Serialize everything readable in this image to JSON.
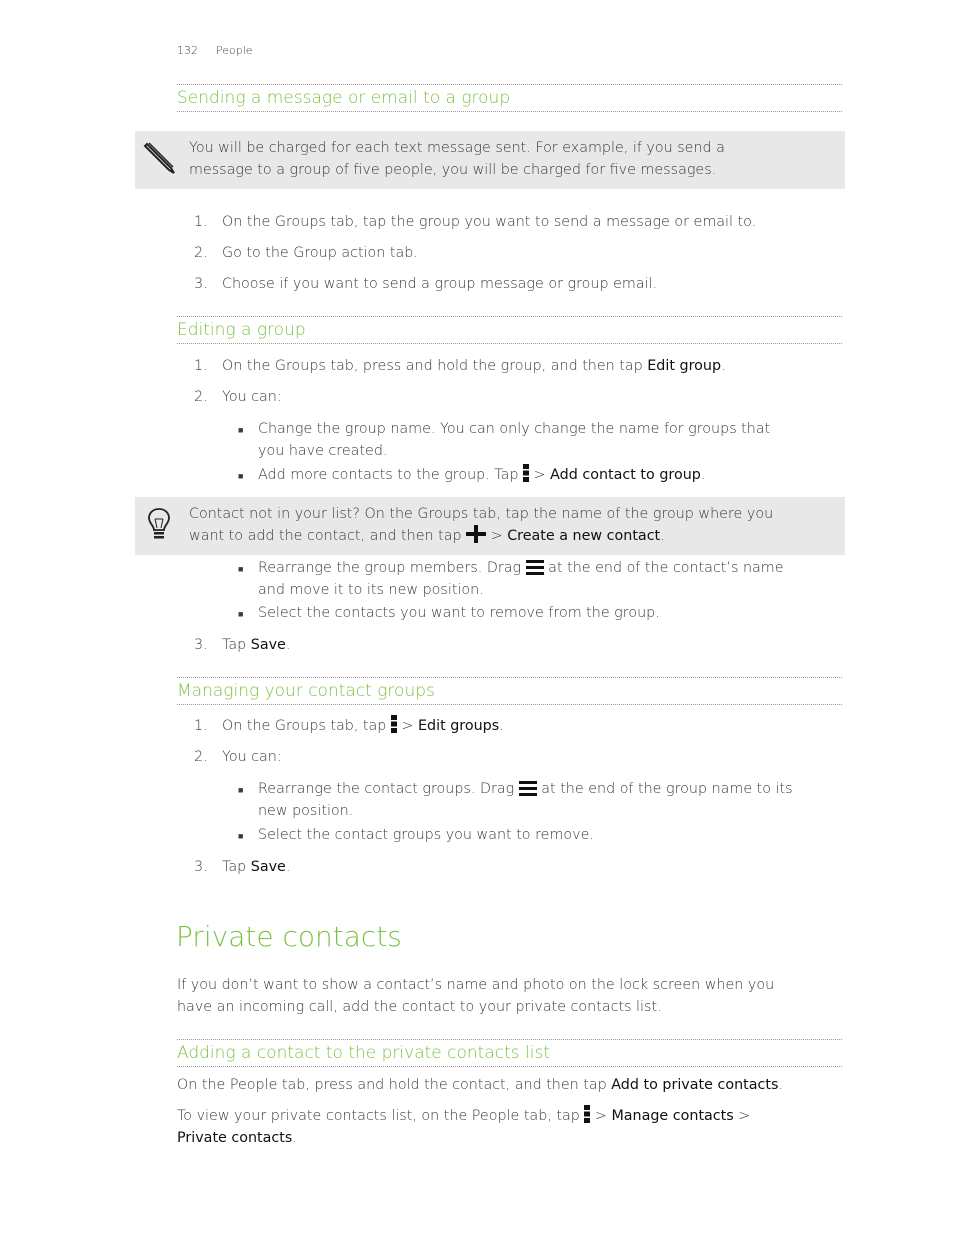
{
  "header": {
    "page_number": "132",
    "chapter": "People"
  },
  "section1": {
    "title": "Sending a message or email to a group",
    "note": {
      "icon": "pencil-icon",
      "lines": [
        "You will be charged for each text message sent. For example, if you send a",
        "message to a group of five people, you will be charged for five messages."
      ]
    },
    "steps": [
      {
        "n": "1.",
        "text": "On the Groups tab, tap the group you want to send a message or email to."
      },
      {
        "n": "2.",
        "text": "Go to the Group action tab."
      },
      {
        "n": "3.",
        "text": "Choose if you want to send a group message or group email."
      }
    ]
  },
  "section2": {
    "title": "Editing a group",
    "step1": {
      "n": "1.",
      "pre": "On the Groups tab, press and hold the group, and then tap ",
      "key": "Edit group",
      "post": "."
    },
    "step2": {
      "n": "2.",
      "text": "You can:"
    },
    "bullets": {
      "b1_l1": "Change the group name. You can only change the name for groups that",
      "b1_l2": "you have created.",
      "b2_pre": "Add more contacts to the group. Tap ",
      "b2_mid": " > ",
      "b2_key": "Add contact to group",
      "b2_post": ".",
      "b3_pre": "Rearrange the group members. Drag ",
      "b3_post": " at the end of the contact’s name",
      "b3_l2": "and move it to its new position.",
      "b4": "Select the contacts you want to remove from the group."
    },
    "tip": {
      "icon": "lightbulb-icon",
      "line1": "Contact not in your list? On the Groups tab, tap the name of the group where you",
      "line2_pre": "want to add the contact, and then tap ",
      "line2_mid": " > ",
      "line2_key": "Create a new contact",
      "line2_post": "."
    },
    "step3": {
      "n": "3.",
      "pre": "Tap ",
      "key": "Save",
      "post": "."
    }
  },
  "section3": {
    "title": "Managing your contact groups",
    "step1": {
      "n": "1.",
      "pre": "On the Groups tab, tap ",
      "mid": " > ",
      "key": "Edit groups",
      "post": "."
    },
    "step2": {
      "n": "2.",
      "text": "You can:"
    },
    "b1_pre": "Rearrange the contact groups. Drag ",
    "b1_post": " at the end of the group name to its",
    "b1_l2": "new position.",
    "b2": "Select the contact groups you want to remove.",
    "step3": {
      "n": "3.",
      "pre": "Tap ",
      "key": "Save",
      "post": "."
    }
  },
  "private": {
    "title": "Private contacts",
    "intro_l1": "If you don’t want to show a contact’s name and photo on the lock screen when you",
    "intro_l2": "have an incoming call, add the contact to your private contacts list.",
    "sub_title": "Adding a contact to the private contacts list",
    "p1_pre": "On the People tab, press and hold the contact, and then tap ",
    "p1_key": "Add to private contacts",
    "p1_post": ".",
    "p2_pre": "To view your private contacts list, on the People tab, tap ",
    "p2_mid": " > ",
    "p2_key": "Manage contacts",
    "p2_post": " >",
    "p2_l2_key": "Private contacts",
    "p2_l2_post": "."
  },
  "colors": {
    "accent": "#7dc242",
    "note_bg": "#e8e8e8"
  }
}
